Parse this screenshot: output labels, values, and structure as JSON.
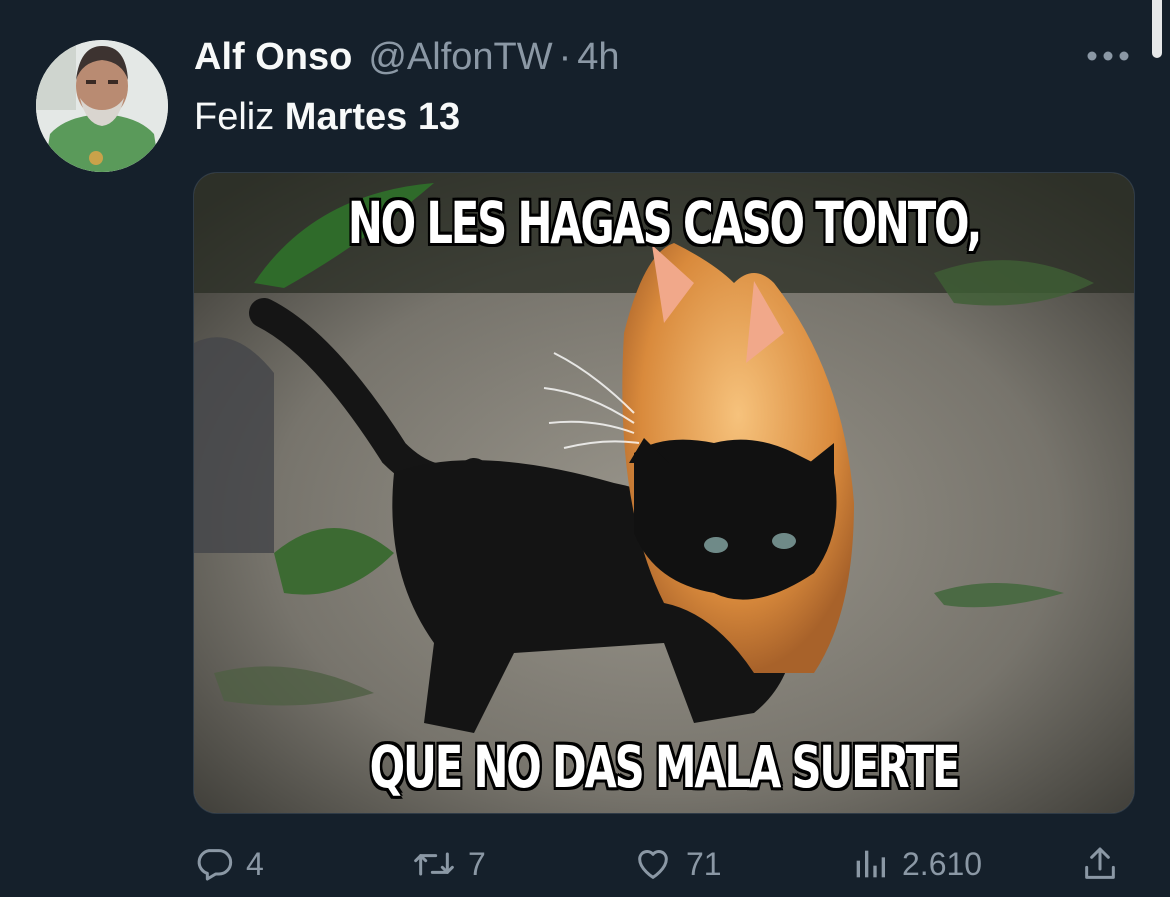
{
  "tweet": {
    "display_name": "Alf Onso",
    "handle": "@AlfonTW",
    "separator": "·",
    "time": "4h",
    "text_plain": "Feliz ",
    "text_bold": "Martes 13"
  },
  "media": {
    "top_caption": "NO LES HAGAS CASO TONTO,",
    "bottom_caption": "QUE NO DAS MALA SUERTE"
  },
  "actions": {
    "reply_count": "4",
    "retweet_count": "7",
    "like_count": "71",
    "views_count": "2.610"
  },
  "icons": {
    "more": "more-horizontal-icon",
    "reply": "reply-icon",
    "retweet": "retweet-icon",
    "like": "heart-icon",
    "views": "views-icon",
    "share": "share-icon"
  },
  "colors": {
    "background": "#15202b",
    "text_primary": "#f7f9f9",
    "text_secondary": "#8b98a5"
  }
}
